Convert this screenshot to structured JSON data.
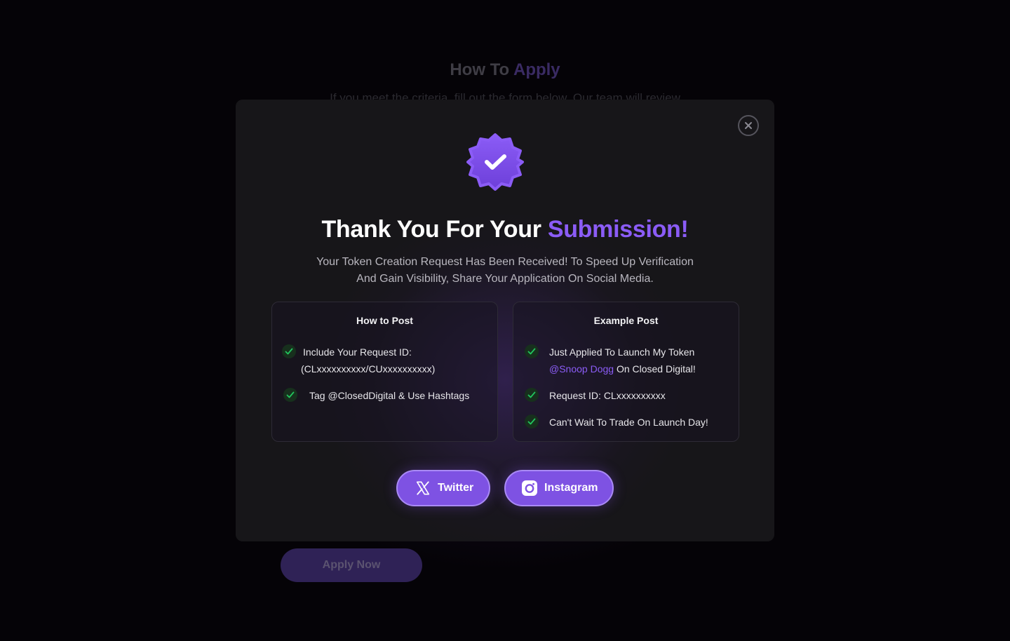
{
  "background": {
    "title_prefix": "How To",
    "title_accent": "Apply",
    "subtitle": "If you meet the criteria, fill out the form below. Our team will review",
    "apply_button": "Apply Now"
  },
  "modal": {
    "close_icon": "close-icon",
    "badge_icon": "verified-badge-icon",
    "title_prefix": "Thank You For Your",
    "title_accent": "Submission!",
    "description_line1": "Your Token Creation Request Has Been Received! To Speed Up Verification",
    "description_line2": "And Gain Visibility, Share Your Application On Social Media.",
    "how_to_post": {
      "title": "How to Post",
      "item1_line1": "Include Your Request ID:",
      "item1_line2": "(CLxxxxxxxxxx/CUxxxxxxxxxx)",
      "item2": "Tag @ClosedDigital & Use Hashtags"
    },
    "example_post": {
      "title": "Example Post",
      "item1_line1": "Just Applied To Launch My Token",
      "item1_mention": "@Snoop Dogg",
      "item1_rest": " On Closed Digital!",
      "item2": "Request ID: CLxxxxxxxxxx",
      "item3": "Can't Wait To Trade On Launch Day!"
    },
    "buttons": {
      "twitter": "Twitter",
      "instagram": "Instagram"
    }
  },
  "colors": {
    "accent": "#8b5cf6",
    "button_bg": "#7e52e3",
    "check_green": "#22c55e"
  }
}
